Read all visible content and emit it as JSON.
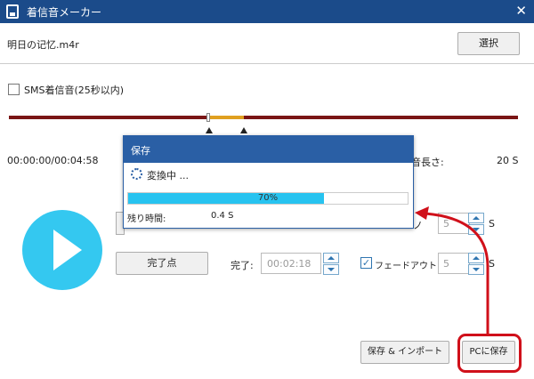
{
  "window": {
    "title": "着信音メーカー",
    "close_glyph": "✕",
    "app_icon": "phone-icon"
  },
  "file": {
    "name": "明日の记忆.m4r",
    "select_label": "選択"
  },
  "sms": {
    "label": "SMS着信音(25秒以内)",
    "checked": false
  },
  "timeline": {
    "time_display": "00:00:00/00:04:58",
    "length_label": "音長さ:",
    "length_value": "20 S"
  },
  "end_point": {
    "button_label": "完了点",
    "label": "完了:",
    "time_value": "00:02:18"
  },
  "fade_out": {
    "label": "フェードアウト",
    "checked": true,
    "check_glyph": "✓",
    "value": "5",
    "unit": "S"
  },
  "fade_in": {
    "partial_label": "ノ",
    "value": "5",
    "unit": "S"
  },
  "buttons": {
    "save_import": "保存 & インポート",
    "pc_save": "PCに保存"
  },
  "dialog": {
    "title": "保存",
    "status": "変換中 ...",
    "progress_text": "70%",
    "progress_fraction": 0.7,
    "remaining_label": "残り時間:",
    "remaining_value": "0.4 S"
  },
  "colors": {
    "titlebar": "#1b4b8a",
    "accent": "#34c8f0",
    "highlight": "#d0101a",
    "track": "#7a1515",
    "selection": "#e0a020"
  }
}
